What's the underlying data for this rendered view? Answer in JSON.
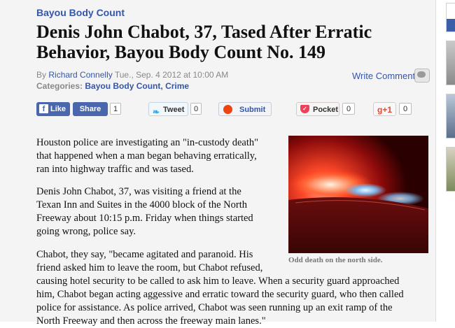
{
  "article": {
    "section": "Bayou Body Count",
    "headline": "Denis John Chabot, 37, Tased After Erratic Behavior, Bayou Body Count No. 149",
    "byline": {
      "by": "By",
      "author": "Richard Connelly",
      "date": "Tue., Sep. 4 2012 at 10:00 AM",
      "categories_label": "Categories:",
      "categories": [
        "Bayou Body Count",
        "Crime"
      ],
      "separator": ","
    },
    "write_comment": "Write Comment",
    "image_caption": "Odd death on the north side.",
    "paragraphs": [
      [
        "Houston police are investigating an \"in-custody death\"",
        "that happened when a man began behaving erratically,",
        "ran into highway traffic and was tased."
      ],
      [
        "Denis John Chabot, 37, was visiting a friend at the",
        "Texan Inn and Suites in the 4000 block of the North",
        "Freeway about 10:15 p.m. Friday when things started",
        "going wrong, police say."
      ],
      [
        "Chabot, they say, \"became agitated and paranoid. His",
        "friend asked him to leave the room, but Chabot refused,",
        "causing hotel security to be called to ask him to leave. When a security guard approached",
        "him, Chabot began acting aggessive and erratic toward the security guard, who then called",
        "police for assistance. As police arrived, Chabot was seen running up an exit ramp of the",
        "North Freeway and then across the freeway main lanes.\""
      ]
    ]
  },
  "share_bar": {
    "facebook_like": "Like",
    "facebook_icon": "f",
    "facebook_share": "Share",
    "facebook_count": "1",
    "tweet": "Tweet",
    "tweet_count": "0",
    "submit": "Submit",
    "pocket": "Pocket",
    "pocket_count": "0",
    "gplus": "g+1",
    "gplus_count": "0"
  },
  "icons": {
    "facebook": "facebook-icon",
    "twitter": "twitter-bird-icon",
    "stumbleupon": "stumbleupon-icon",
    "pocket": "pocket-icon",
    "comment": "comment-bubble-icon"
  },
  "colors": {
    "link": "#3355aa",
    "facebook": "#4a66ad",
    "pocket": "#ee4056",
    "gplus": "#dd4b39",
    "background": "#f4f4f4"
  }
}
